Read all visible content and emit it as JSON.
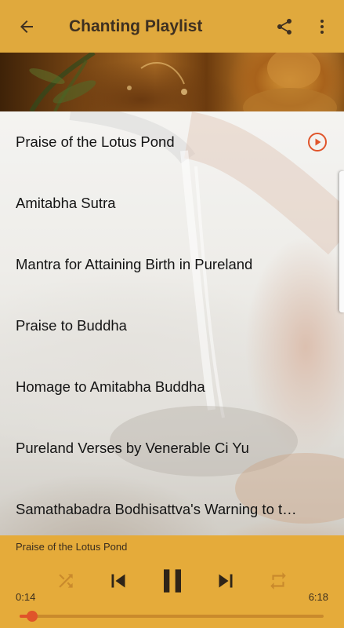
{
  "app_bar": {
    "title": "Chanting Playlist",
    "back_icon": "arrow-left-icon",
    "share_icon": "share-icon",
    "menu_icon": "more-vert-icon"
  },
  "playlist": {
    "tracks": [
      {
        "name": "Praise of the Lotus Pond",
        "playing": true
      },
      {
        "name": "Amitabha Sutra",
        "playing": false
      },
      {
        "name": "Mantra for Attaining Birth in Pureland",
        "playing": false
      },
      {
        "name": "Praise to Buddha",
        "playing": false
      },
      {
        "name": "Homage to Amitabha Buddha",
        "playing": false
      },
      {
        "name": "Pureland Verses by Venerable Ci Yu",
        "playing": false
      },
      {
        "name": "Samathabadra Bodhisattva's Warning to the Assembly",
        "playing": false
      }
    ]
  },
  "player": {
    "now_playing": "Praise of the Lotus Pond",
    "current_time": "0:14",
    "total_time": "6:18",
    "progress": 0.04,
    "icons": {
      "shuffle": "shuffle-icon",
      "previous": "skip-previous-icon",
      "pause": "pause-icon",
      "next": "skip-next-icon",
      "repeat": "repeat-icon"
    }
  },
  "colors": {
    "accent": "#e5ab3a",
    "play_indicator": "#e0542a",
    "text_dark": "#3e3021"
  }
}
